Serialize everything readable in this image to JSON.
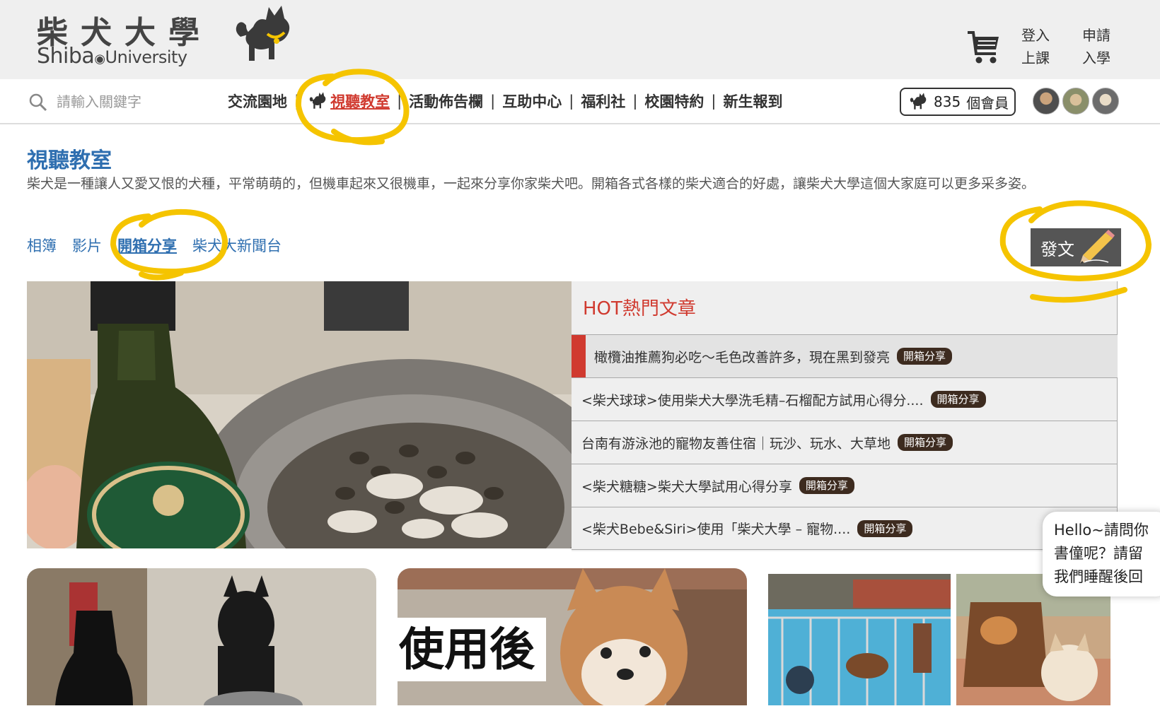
{
  "header": {
    "logo_cn": "柴犬大學",
    "logo_en_1": "Shiba",
    "logo_en_2": "University",
    "login_line1": "登入",
    "login_line2": "上課",
    "apply_line1": "申請",
    "apply_line2": "入學",
    "cart_icon": "cart-icon"
  },
  "nav": {
    "search_placeholder": "請輸入關鍵字",
    "items": [
      "交流園地",
      "視聽教室",
      "活動佈告欄",
      "互助中心",
      "福利社",
      "校園特約",
      "新生報到"
    ],
    "separator": "|",
    "active_item": "視聽教室",
    "member_count": "835",
    "member_label": "個會員"
  },
  "main": {
    "title": "視聽教室",
    "description": "柴犬是一種讓人又愛又恨的犬種，平常萌萌的，但機車起來又很機車，一起來分享你家柴犬吧。開箱各式各樣的柴犬適合的好處，讓柴犬大學這個大家庭可以更多采多姿。",
    "sub_tabs": [
      "相簿",
      "影片",
      "開箱分享",
      "柴犬大新聞台"
    ],
    "current_sub_tab": "開箱分享",
    "post_button": "發文"
  },
  "hot": {
    "title": "HOT熱門文章",
    "articles": [
      {
        "title": "橄欖油推薦狗必吃～毛色改善許多，現在黑到發亮",
        "tag": "開箱分享"
      },
      {
        "title": "<柴犬球球>使用柴犬大學洗毛精–石榴配方試用心得分....",
        "tag": "開箱分享"
      },
      {
        "title": "台南有游泳池的寵物友善住宿｜玩沙、玩水、大草地",
        "tag": "開箱分享"
      },
      {
        "title": "<柴犬糖糖>柴犬大學試用心得分享",
        "tag": "開箱分享"
      },
      {
        "title": "<柴犬Bebe&Siri>使用「柴犬大學 – 寵物....",
        "tag": "開箱分享"
      }
    ]
  },
  "cards": {
    "card2_caption": "使用後"
  },
  "chat": {
    "line1": "Hello~請問你",
    "line2": "書僮呢？請留",
    "line3": "我們睡醒後回"
  },
  "colors": {
    "accent_red": "#d03a2f",
    "link_blue": "#2f6fb0",
    "highlight_yellow": "#f5c400",
    "tag_brown": "#3d2b1f"
  }
}
